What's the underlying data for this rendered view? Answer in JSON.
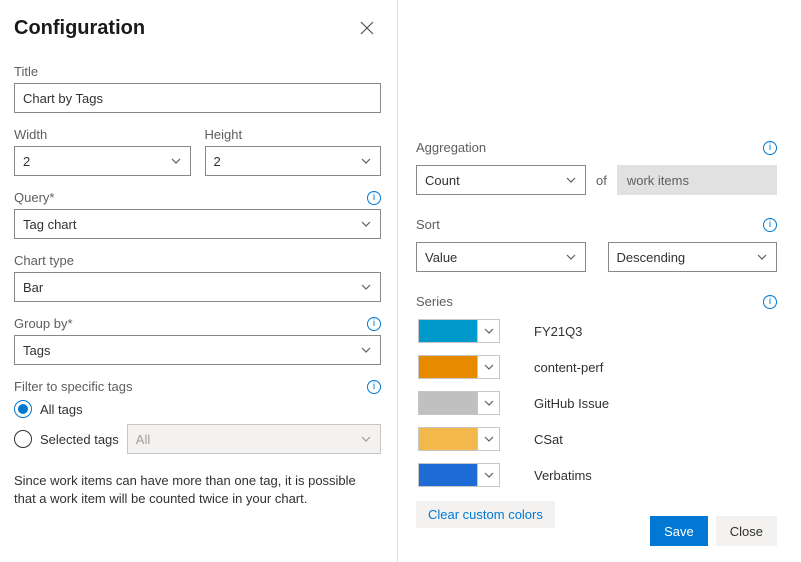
{
  "header": {
    "title": "Configuration"
  },
  "left": {
    "title_label": "Title",
    "title_value": "Chart by Tags",
    "width_label": "Width",
    "width_value": "2",
    "height_label": "Height",
    "height_value": "2",
    "query_label": "Query",
    "query_value": "Tag chart",
    "charttype_label": "Chart type",
    "charttype_value": "Bar",
    "groupby_label": "Group by",
    "groupby_value": "Tags",
    "filter_label": "Filter to specific tags",
    "radio_all": "All tags",
    "radio_selected": "Selected tags",
    "selected_placeholder": "All",
    "help": "Since work items can have more than one tag, it is possible that a work item will be counted twice in your chart."
  },
  "right": {
    "agg_label": "Aggregation",
    "agg_value": "Count",
    "of_label": "of",
    "of_value": "work items",
    "sort_label": "Sort",
    "sort_field": "Value",
    "sort_dir": "Descending",
    "series_label": "Series",
    "series": [
      {
        "color": "#0099cc",
        "name": "FY21Q3"
      },
      {
        "color": "#e68a00",
        "name": "content-perf"
      },
      {
        "color": "#c0c0c0",
        "name": "GitHub Issue"
      },
      {
        "color": "#f2b84b",
        "name": "CSat"
      },
      {
        "color": "#1e6bd6",
        "name": "Verbatims"
      }
    ],
    "clear_label": "Clear custom colors",
    "save_label": "Save",
    "close_label": "Close"
  }
}
